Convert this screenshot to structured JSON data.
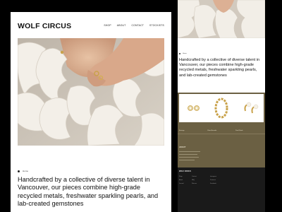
{
  "site": {
    "brand": "WOLF CIRCUS",
    "nav": [
      "Shop",
      "About",
      "Contact",
      "Stockists"
    ]
  },
  "hero": {
    "image_alt": "Model in ruffled blouse wearing gold rings",
    "bg_color": "#cfc7bb"
  },
  "intro": {
    "tag": "Home",
    "text": "Handcrafted by a collective of diverse talent in Vancouver, our pieces combine high-grade recycled metals, freshwater sparkling pearls, and lab-created gemstones"
  },
  "products": {
    "items": [
      {
        "name": "Earrings"
      },
      {
        "name": "Chain Bracelet"
      },
      {
        "name": "Pearl Studs"
      }
    ],
    "bg_color": "#6b6043"
  },
  "about": {
    "title": "ABOUT"
  },
  "footer": {
    "brand": "WOLF CIRCUS",
    "col1": [
      "Shop",
      "About",
      "Journal"
    ],
    "col2": [
      "Contact",
      "FAQ",
      "Returns"
    ],
    "col3": [
      "Instagram",
      "Pinterest",
      "Facebook"
    ]
  }
}
